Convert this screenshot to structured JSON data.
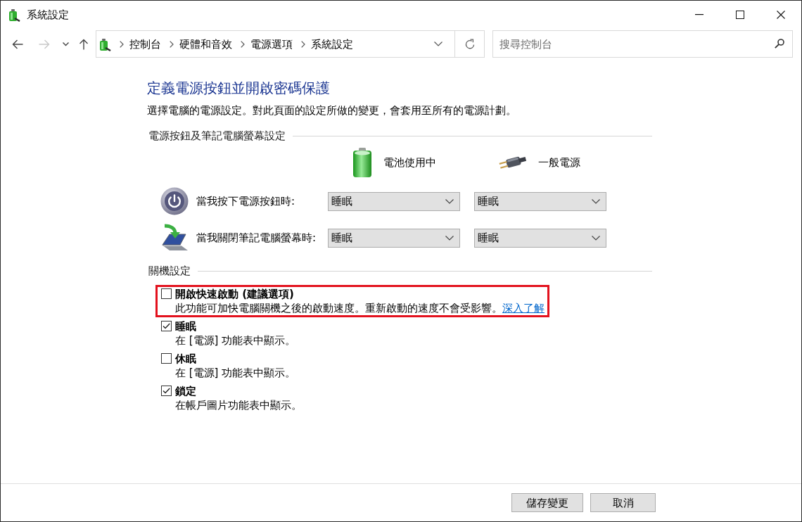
{
  "window": {
    "title": "系統設定"
  },
  "navigation": {
    "buttons": [
      {
        "kind": "back",
        "disabled": false
      },
      {
        "kind": "forward",
        "disabled": true
      },
      {
        "kind": "recent",
        "disabled": false
      },
      {
        "kind": "up",
        "disabled": false
      }
    ],
    "breadcrumbs": [
      "控制台",
      "硬體和音效",
      "電源選項",
      "系統設定"
    ],
    "search": {
      "placeholder": "搜尋控制台"
    }
  },
  "heading": "定義電源按鈕並開啟密碼保護",
  "description": "選擇電腦的電源設定。對此頁面的設定所做的變更，會套用至所有的電源計劃。",
  "power_section": {
    "title": "電源按鈕及筆記電腦螢幕設定",
    "columns": [
      {
        "kind": "battery",
        "label": "電池使用中"
      },
      {
        "kind": "plugged_in",
        "label": "一般電源"
      }
    ],
    "rows": [
      {
        "kind": "power_button",
        "label": "當我按下電源按鈕時:",
        "values": [
          "睡眠",
          "睡眠"
        ]
      },
      {
        "kind": "lid",
        "label": "當我關閉筆記電腦螢幕時:",
        "values": [
          "睡眠",
          "睡眠"
        ]
      }
    ]
  },
  "shutdown_section": {
    "title": "關機設定",
    "options": [
      {
        "label": "開啟快速啟動 (建議選項)",
        "description": "此功能可加快電腦關機之後的啟動速度。重新啟動的速度不會受影響。",
        "link": "深入了解",
        "checked": false,
        "highlighted": true
      },
      {
        "label": "睡眠",
        "description": "在 [電源] 功能表中顯示。",
        "checked": true,
        "highlighted": false
      },
      {
        "label": "休眠",
        "description": "在 [電源] 功能表中顯示。",
        "checked": false,
        "highlighted": false
      },
      {
        "label": "鎖定",
        "description": "在帳戶圖片功能表中顯示。",
        "checked": true,
        "highlighted": false
      }
    ]
  },
  "buttons": [
    "儲存變更",
    "取消"
  ]
}
